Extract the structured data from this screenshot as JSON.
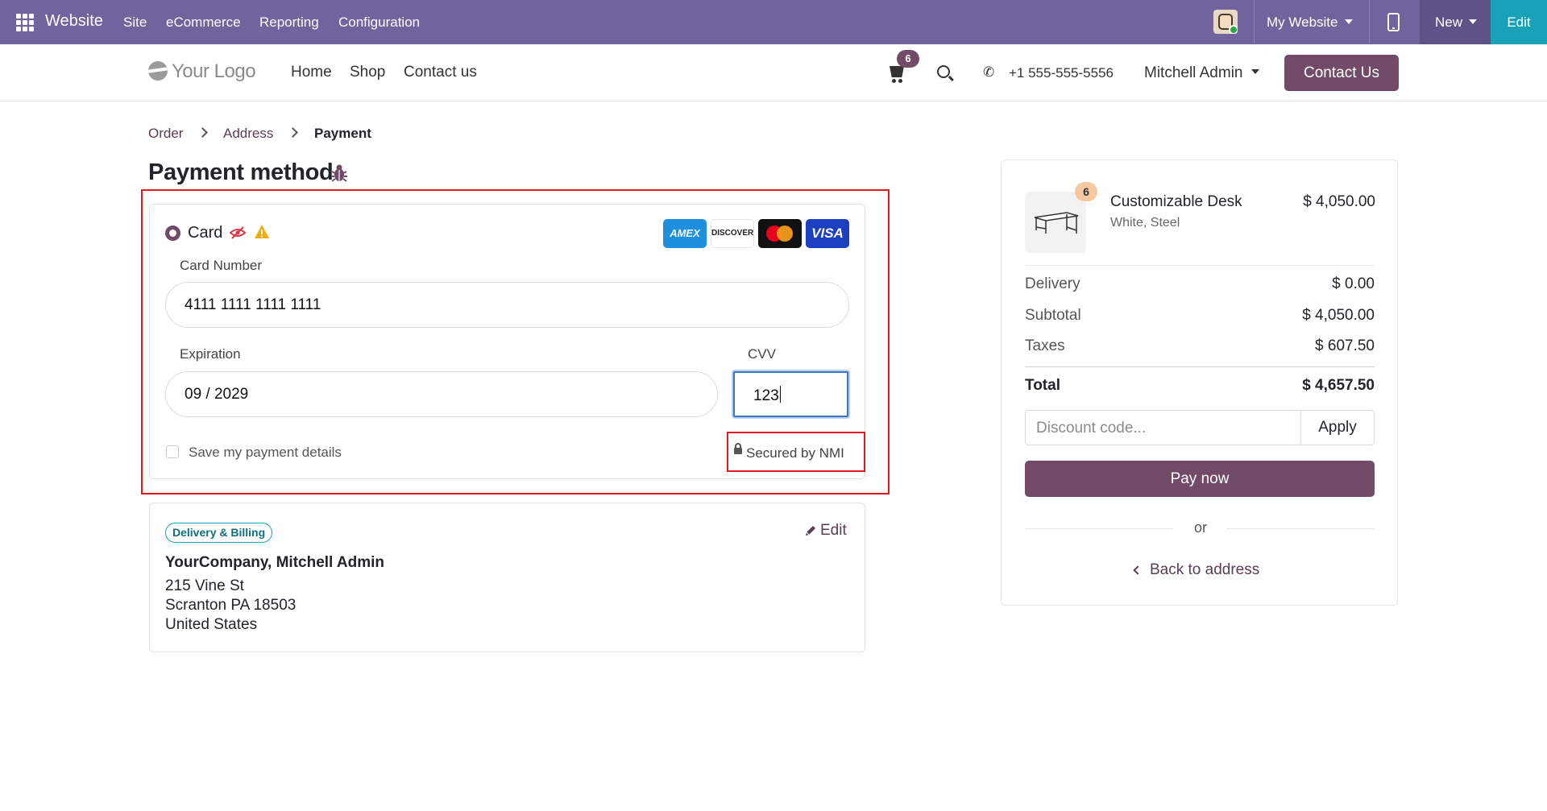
{
  "adminbar": {
    "app_name": "Website",
    "menus": [
      "Site",
      "eCommerce",
      "Reporting",
      "Configuration"
    ],
    "website_switch": "My Website",
    "new_label": "New",
    "edit_label": "Edit",
    "color": "#71639e"
  },
  "header": {
    "logo_text": "Your Logo",
    "nav": [
      "Home",
      "Shop",
      "Contact us"
    ],
    "cart_count": "6",
    "phone": "+1 555-555-5556",
    "user": "Mitchell Admin",
    "contact_button": "Contact Us",
    "accent": "#714b67"
  },
  "breadcrumb": [
    "Order",
    "Address",
    "Payment"
  ],
  "payment": {
    "title": "Payment method",
    "method_label": "Card",
    "card_brands": [
      "AMEX",
      "DISCOVER",
      "Mastercard",
      "VISA"
    ],
    "card_number_label": "Card Number",
    "card_number_value": "4111 1111 1111 1111",
    "expiration_label": "Expiration",
    "expiration_value": "09 / 2029",
    "cvv_label": "CVV",
    "cvv_value": "123",
    "save_label": "Save my payment details",
    "save_checked": false,
    "secured_label": "Secured by NMI"
  },
  "address": {
    "badge": "Delivery & Billing",
    "edit_label": "Edit",
    "name": "YourCompany, Mitchell Admin",
    "lines": [
      "215 Vine St",
      "Scranton PA 18503",
      "United States"
    ]
  },
  "summary": {
    "product": {
      "name": "Customizable Desk",
      "variant": "White, Steel",
      "price": "$ 4,050.00",
      "qty": "6"
    },
    "rows": [
      {
        "label": "Delivery",
        "value": "$ 0.00"
      },
      {
        "label": "Subtotal",
        "value": "$ 4,050.00"
      },
      {
        "label": "Taxes",
        "value": "$ 607.50"
      }
    ],
    "total_label": "Total",
    "total_value": "$ 4,657.50",
    "discount_placeholder": "Discount code...",
    "apply_label": "Apply",
    "pay_label": "Pay now",
    "or_label": "or",
    "back_label": "Back to address"
  }
}
